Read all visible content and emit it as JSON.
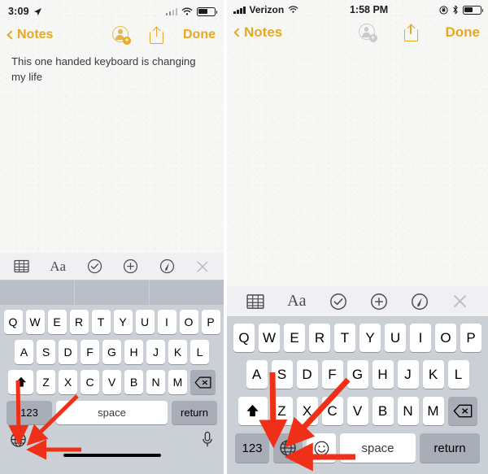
{
  "meta": {
    "accent_yellow": "#e8a820",
    "arrow_red": "#ef2f18",
    "keyboard_bg": "#cbcfd6",
    "key_white": "#ffffff",
    "key_dark": "#a8adb8",
    "paper_bg": "#f7f7f5",
    "text_color": "#3a3a3c"
  },
  "left_panel": {
    "status_bar": {
      "time": "3:09",
      "location_arrow_icon": "location-arrow-icon",
      "signal_icon": "cellular-signal-icon",
      "wifi_icon": "wifi-icon",
      "battery_icon": "battery-icon",
      "battery_level_pct": 58
    },
    "nav_bar": {
      "back_label": "Notes",
      "back_chevron_icon": "chevron-left-icon",
      "add_person_icon": "add-person-icon",
      "add_person_enabled": true,
      "share_icon": "share-icon",
      "done_label": "Done"
    },
    "note": {
      "text": "This one handed keyboard is changing my life"
    },
    "keyboard": {
      "toolbar": [
        {
          "name": "table-icon",
          "label": ""
        },
        {
          "name": "text-format-icon",
          "label": "Aa"
        },
        {
          "name": "checklist-icon",
          "label": ""
        },
        {
          "name": "add-attachment-icon",
          "label": ""
        },
        {
          "name": "markup-pen-icon",
          "label": ""
        },
        {
          "name": "close-keyboard-icon",
          "label": ""
        }
      ],
      "predictive": [
        "",
        "",
        ""
      ],
      "rows": [
        [
          "Q",
          "W",
          "E",
          "R",
          "T",
          "Y",
          "U",
          "I",
          "O",
          "P"
        ],
        [
          "A",
          "S",
          "D",
          "F",
          "G",
          "H",
          "J",
          "K",
          "L"
        ],
        [
          "Z",
          "X",
          "C",
          "V",
          "B",
          "N",
          "M"
        ]
      ],
      "shift_icon": "shift-icon",
      "backspace_icon": "backspace-icon",
      "numbers_label": "123",
      "space_label": "space",
      "return_label": "return",
      "globe_icon": "globe-icon",
      "mic_icon": "microphone-icon",
      "home_indicator": "home-indicator"
    }
  },
  "right_panel": {
    "status_bar": {
      "carrier": "Verizon",
      "time": "1:58 PM",
      "signal_icon": "cellular-signal-icon",
      "wifi_icon": "wifi-icon",
      "rotation_lock_icon": "rotation-lock-icon",
      "bluetooth_icon": "bluetooth-icon",
      "battery_icon": "battery-icon",
      "battery_level_pct": 52
    },
    "nav_bar": {
      "back_label": "Notes",
      "back_chevron_icon": "chevron-left-icon",
      "add_person_icon": "add-person-icon",
      "add_person_enabled": false,
      "share_icon": "share-icon",
      "done_label": "Done"
    },
    "note": {
      "text": ""
    },
    "keyboard": {
      "toolbar": [
        {
          "name": "table-icon",
          "label": ""
        },
        {
          "name": "text-format-icon",
          "label": "Aa"
        },
        {
          "name": "checklist-icon",
          "label": ""
        },
        {
          "name": "add-attachment-icon",
          "label": ""
        },
        {
          "name": "markup-pen-icon",
          "label": ""
        },
        {
          "name": "close-keyboard-icon",
          "label": ""
        }
      ],
      "rows": [
        [
          "Q",
          "W",
          "E",
          "R",
          "T",
          "Y",
          "U",
          "I",
          "O",
          "P"
        ],
        [
          "A",
          "S",
          "D",
          "F",
          "G",
          "H",
          "J",
          "K",
          "L"
        ],
        [
          "Z",
          "X",
          "C",
          "V",
          "B",
          "N",
          "M"
        ]
      ],
      "shift_icon": "shift-icon",
      "backspace_icon": "backspace-icon",
      "numbers_label": "123",
      "globe_icon": "globe-icon",
      "emoji_icon": "emoji-icon",
      "space_label": "space",
      "return_label": "return"
    }
  },
  "annotations": {
    "arrow_count": 6,
    "target": "globe-key",
    "color": "#ef2f18"
  }
}
